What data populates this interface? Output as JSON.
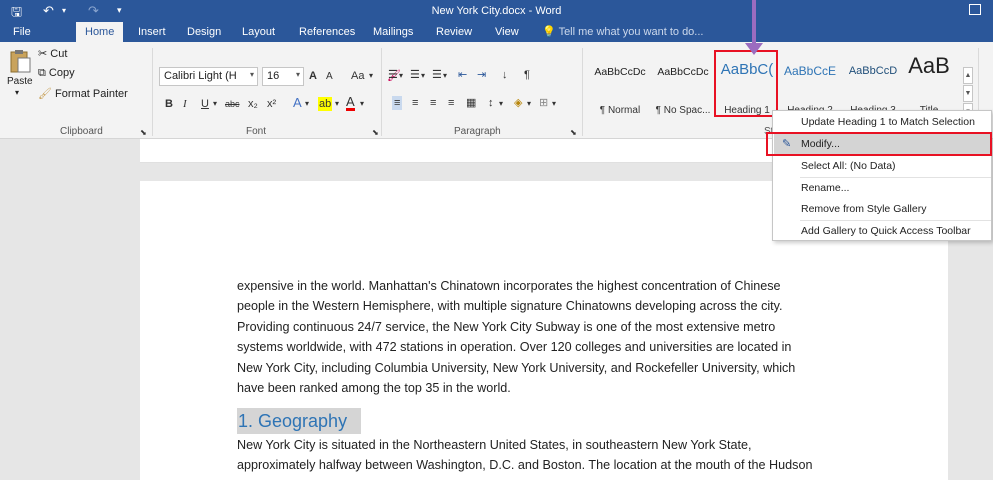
{
  "title": {
    "text": "New York City.docx - Word"
  },
  "quick_access": {
    "save_glyph": "🖫",
    "undo_glyph": "↶",
    "undo_dd": "▾",
    "redo_glyph": "↷",
    "customize_glyph": "▾"
  },
  "tabs": [
    "File",
    "Home",
    "Insert",
    "Design",
    "Layout",
    "References",
    "Mailings",
    "Review",
    "View"
  ],
  "tell_me": "Tell me what you want to do...",
  "clipboard": {
    "paste": "Paste",
    "paste_dd": "▾",
    "cut": "Cut",
    "copy": "Copy",
    "format_painter": "Format Painter",
    "label": "Clipboard"
  },
  "font": {
    "name": "Calibri Light (H",
    "size": "16",
    "grow": "A",
    "shrink": "A",
    "case": "Aa",
    "case_dd": "▾",
    "clear": "🖌",
    "bold": "B",
    "italic": "I",
    "underline": "U",
    "underline_dd": "▾",
    "strike": "abc",
    "sub": "x₂",
    "sup": "x²",
    "effects": "A",
    "effects_dd": "▾",
    "highlight": "ab",
    "highlight_dd": "▾",
    "color": "A",
    "color_dd": "▾",
    "label": "Font",
    "dd": "▾"
  },
  "paragraph": {
    "bullets": "☰",
    "bullets_dd": "▾",
    "numbering": "☰",
    "numbering_dd": "▾",
    "multilevel": "☰",
    "multilevel_dd": "▾",
    "decrease": "⇤",
    "increase": "⇥",
    "sort": "↓",
    "pilcrow": "¶",
    "align_left": "≡",
    "align_center": "≡",
    "align_right": "≡",
    "justify": "≡",
    "distributed": "▦",
    "spacing": "↕",
    "spacing_dd": "▾",
    "shading": "◈",
    "shading_dd": "▾",
    "borders": "⊞",
    "borders_dd": "▾",
    "label": "Paragraph"
  },
  "styles": {
    "items": [
      {
        "preview": "AaBbCcDc",
        "name": "¶ Normal"
      },
      {
        "preview": "AaBbCcDc",
        "name": "¶ No Spac..."
      },
      {
        "preview": "AaBbC(",
        "name": "Heading 1"
      },
      {
        "preview": "AaBbCcE",
        "name": "Heading 2"
      },
      {
        "preview": "AaBbCcD",
        "name": "Heading 3"
      },
      {
        "preview": "AaB",
        "name": "Title"
      }
    ],
    "label_partial": "St",
    "up": "▲",
    "down": "▼",
    "more": "▾"
  },
  "launcher": "⬊",
  "context_menu": {
    "items": [
      "Update Heading 1 to Match Selection",
      "Modify...",
      "Select All: (No Data)",
      "Rename...",
      "Remove from Style Gallery",
      "Add Gallery to Quick Access Toolbar"
    ],
    "modify_icon": "✎"
  },
  "document": {
    "intro_lines": [
      "expensive in the world. Manhattan's Chinatown incorporates the highest concentration of Chinese",
      "people in the Western Hemisphere, with multiple signature Chinatowns developing across the city.",
      "Providing continuous 24/7 service, the New York City Subway is one of the most extensive metro",
      "systems worldwide, with 472 stations in operation. Over 120 colleges and universities are located in",
      "New York City, including Columbia University, New York University, and Rockefeller University, which",
      "have been ranked among the top 35 in the world."
    ],
    "heading": "1. Geography",
    "para2_lines": [
      "New York City is situated in the Northeastern United States, in southeastern New York State,",
      "approximately halfway between Washington, D.C. and Boston. The location at the mouth of the Hudson"
    ]
  },
  "colors": {
    "title_bar": "#2b579a",
    "ribbon": "#f3f3f3",
    "highlight_box": "#e81123",
    "arrow": "#9b6cc0",
    "heading_text": "#2e74b5"
  },
  "icons": [
    "save-icon",
    "undo-icon",
    "redo-icon",
    "ribbon-display-icon",
    "lightbulb-icon",
    "paste-icon",
    "cut-icon",
    "copy-icon",
    "format-painter-icon",
    "pencil-modify-icon",
    "dialog-launcher-icon"
  ]
}
